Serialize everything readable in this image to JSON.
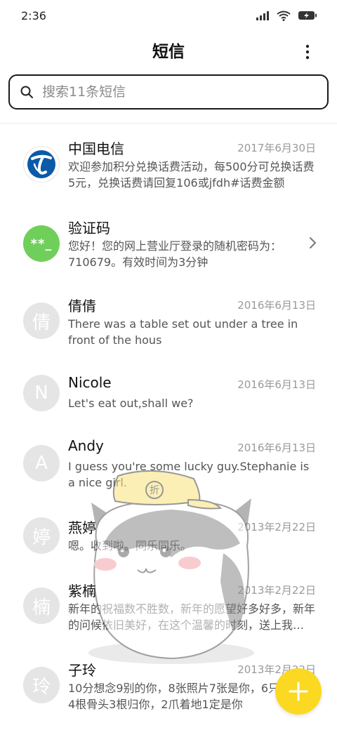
{
  "status_bar": {
    "time": "2:36",
    "icons": [
      "signal-icon",
      "wifi-icon",
      "battery-charging-icon"
    ]
  },
  "header": {
    "title": "短信",
    "more_icon": "more-vert-icon"
  },
  "search": {
    "placeholder": "搜索11条短信",
    "value": "",
    "icon": "search-icon"
  },
  "conversations": [
    {
      "name": "中国电信",
      "date": "2017年6月30日",
      "preview": "欢迎参加积分兑换话费活动，每500分可兑换话费5元，兑换话费请回复106或jfdh#话费金额",
      "avatar": "",
      "avatar_type": "china-telecom-logo"
    },
    {
      "name": "验证码",
      "date": "",
      "preview": "您好！您的网上营业厅登录的随机密码为：710679。有效时间为3分钟",
      "avatar": "**_",
      "avatar_type": "verification-code",
      "has_chevron": true
    },
    {
      "name": "倩倩",
      "date": "2016年6月13日",
      "preview": "There was a table set out under a tree in front of the hous",
      "avatar": "倩"
    },
    {
      "name": "Nicole",
      "date": "2016年6月13日",
      "preview": "Let's eat out,shall we?",
      "avatar": "N"
    },
    {
      "name": "Andy",
      "date": "2016年6月13日",
      "preview": "I guess you're some lucky guy.Stephanie is a nice girl.",
      "avatar": "A"
    },
    {
      "name": "燕婷",
      "date": "2013年2月22日",
      "preview": "嗯。收到啦。同乐同乐。",
      "avatar": "婷"
    },
    {
      "name": "紫楠",
      "date": "2013年2月22日",
      "preview": "新年的祝福数不胜数，新年的愿望好多好多，新年的问候依旧美好，在这个温馨的时刻，送上我的祝福",
      "avatar": "楠"
    },
    {
      "name": "子玲",
      "date": "2013年2月22日",
      "preview": "10分想念9别的你，8张照片7张是你，6只像你，4根骨头3根归你，2爪着地1定是你",
      "avatar": "玲"
    }
  ],
  "colors": {
    "accent": "#fbd922",
    "verification_avatar": "#6fcf5a",
    "telecom_blue": "#0a5aa8",
    "avatar_gray": "#e5e5e5"
  },
  "fab": {
    "icon": "plus-icon"
  },
  "mascot": {
    "icon": "husky-mascot-illustration",
    "cap_text": "折"
  }
}
